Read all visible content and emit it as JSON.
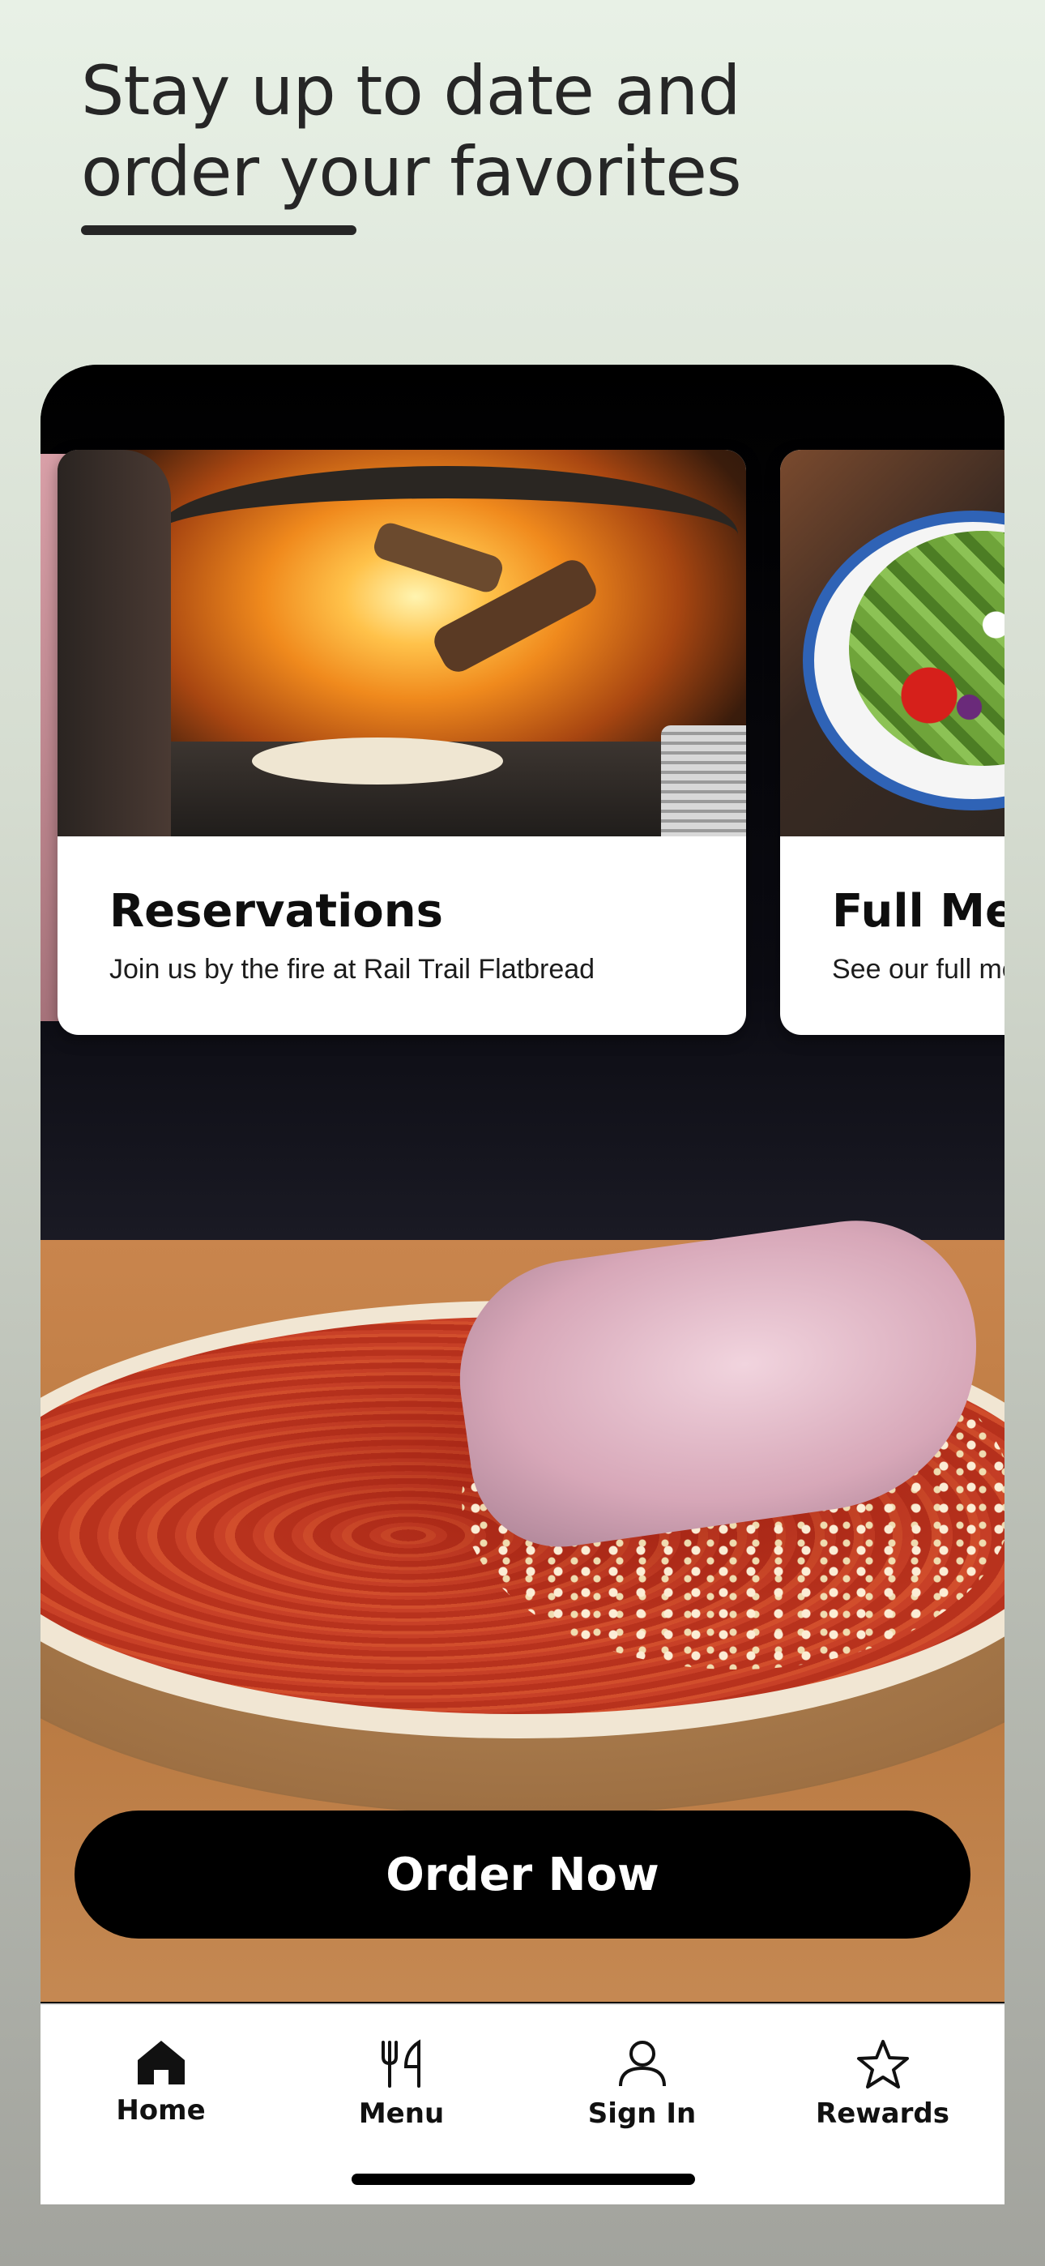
{
  "header": {
    "line1": "Stay up to date and",
    "line2": "order your favorites"
  },
  "carousel": {
    "cards": [
      {
        "title": "Reservations",
        "subtitle": "Join us by the fire at Rail Trail Flatbread"
      },
      {
        "title": "Full Menu",
        "subtitle": "See our full menu"
      }
    ]
  },
  "order_button": {
    "label": "Order Now"
  },
  "tabbar": {
    "tabs": [
      {
        "label": "Home",
        "icon": "home-icon"
      },
      {
        "label": "Menu",
        "icon": "fork-knife-icon"
      },
      {
        "label": "Sign In",
        "icon": "user-icon"
      },
      {
        "label": "Rewards",
        "icon": "star-icon"
      }
    ]
  }
}
